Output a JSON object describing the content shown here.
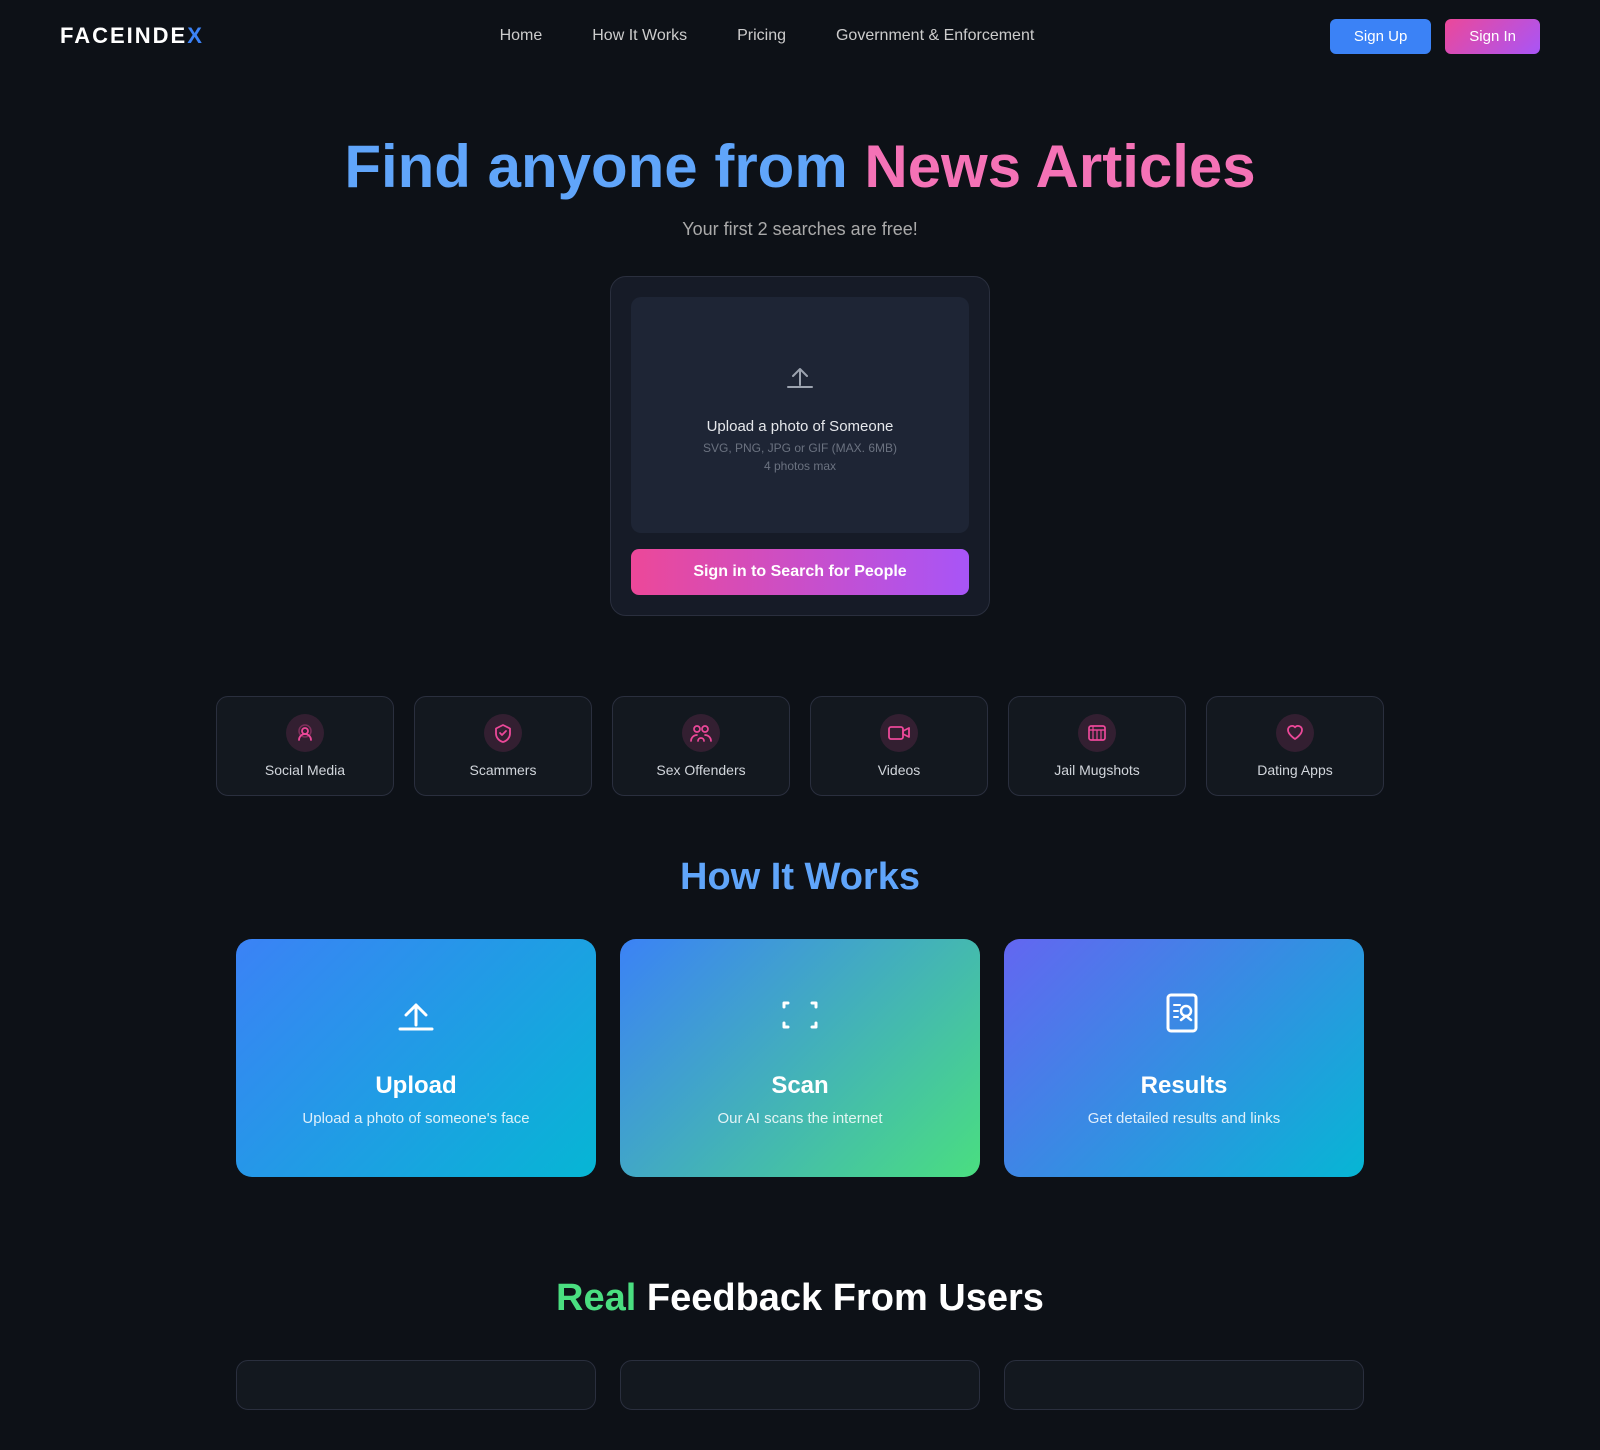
{
  "brand": {
    "logo_text": "FACEINDE",
    "logo_x": "X"
  },
  "nav": {
    "links": [
      {
        "label": "Home",
        "id": "home"
      },
      {
        "label": "How It Works",
        "id": "how-it-works"
      },
      {
        "label": "Pricing",
        "id": "pricing"
      },
      {
        "label": "Government & Enforcement",
        "id": "gov"
      }
    ],
    "signup_label": "Sign Up",
    "signin_label": "Sign In"
  },
  "hero": {
    "title_part1": "Find anyone from ",
    "title_part2": "News Articles",
    "subtitle": "Your first 2 searches are free!",
    "upload_label": "Upload a photo of Someone",
    "upload_formats": "SVG, PNG, JPG or GIF (MAX. 6MB)",
    "upload_max": "4 photos max",
    "search_button": "Sign in to Search for People"
  },
  "categories": [
    {
      "label": "Social Media",
      "icon": "🔍"
    },
    {
      "label": "Scammers",
      "icon": "🛡"
    },
    {
      "label": "Sex Offenders",
      "icon": "👥"
    },
    {
      "label": "Videos",
      "icon": "📹"
    },
    {
      "label": "Jail Mugshots",
      "icon": "🗂"
    },
    {
      "label": "Dating Apps",
      "icon": "❤"
    }
  ],
  "how_it_works": {
    "title": "How It Works",
    "steps": [
      {
        "id": "upload",
        "title": "Upload",
        "desc": "Upload a photo of someone's face",
        "icon": "upload"
      },
      {
        "id": "scan",
        "title": "Scan",
        "desc": "Our AI scans the internet",
        "icon": "scan"
      },
      {
        "id": "results",
        "title": "Results",
        "desc": "Get detailed results and links",
        "icon": "results"
      }
    ]
  },
  "feedback": {
    "title_green": "Real",
    "title_white": " Feedback From Users"
  }
}
